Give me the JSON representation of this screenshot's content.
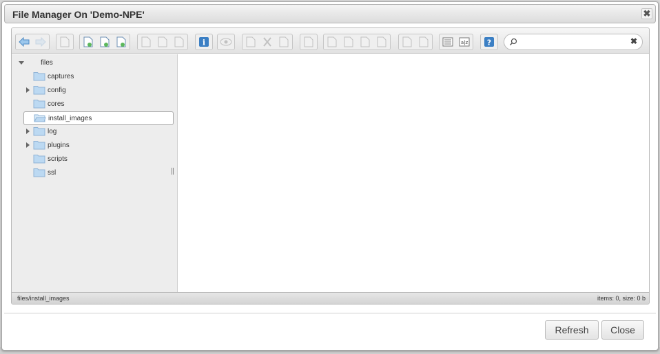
{
  "dialog": {
    "title": "File Manager On 'Demo-NPE'",
    "close_glyph": "✖"
  },
  "toolbar": {
    "groups": [
      {
        "buttons": [
          {
            "icon": "back-arrow-icon",
            "enabled": true
          },
          {
            "icon": "forward-arrow-icon",
            "enabled": false
          }
        ]
      },
      {
        "buttons": [
          {
            "icon": "reload-icon",
            "enabled": false
          }
        ]
      },
      {
        "buttons": [
          {
            "icon": "home-icon",
            "enabled": true
          },
          {
            "icon": "up-folder-icon",
            "enabled": true
          },
          {
            "icon": "save-icon",
            "enabled": true
          }
        ]
      },
      {
        "buttons": [
          {
            "icon": "new-folder-icon",
            "enabled": false
          },
          {
            "icon": "floppy-icon",
            "enabled": false
          },
          {
            "icon": "cursor-icon",
            "enabled": false
          }
        ]
      },
      {
        "buttons": [
          {
            "icon": "info-icon",
            "enabled": true
          }
        ]
      },
      {
        "buttons": [
          {
            "icon": "preview-eye-icon",
            "enabled": false
          }
        ]
      },
      {
        "buttons": [
          {
            "icon": "copy-icon",
            "enabled": false
          },
          {
            "icon": "cut-icon",
            "enabled": false
          },
          {
            "icon": "paste-icon",
            "enabled": false
          }
        ]
      },
      {
        "buttons": [
          {
            "icon": "delete-icon",
            "enabled": false
          }
        ]
      },
      {
        "buttons": [
          {
            "icon": "duplicate-icon",
            "enabled": false
          },
          {
            "icon": "select-icon",
            "enabled": false
          },
          {
            "icon": "edit-icon",
            "enabled": false
          },
          {
            "icon": "resize-icon",
            "enabled": false
          }
        ]
      },
      {
        "buttons": [
          {
            "icon": "extract-icon",
            "enabled": false
          },
          {
            "icon": "archive-icon",
            "enabled": false
          }
        ]
      },
      {
        "buttons": [
          {
            "icon": "list-view-icon",
            "enabled": true
          },
          {
            "icon": "sort-icon",
            "enabled": true
          }
        ]
      },
      {
        "buttons": [
          {
            "icon": "help-icon",
            "enabled": true
          }
        ]
      }
    ],
    "search": {
      "value": "",
      "placeholder": "",
      "clear_glyph": "✖"
    }
  },
  "tree": {
    "root": {
      "label": "files",
      "expanded": true
    },
    "items": [
      {
        "label": "captures",
        "has_children": false,
        "selected": false
      },
      {
        "label": "config",
        "has_children": true,
        "selected": false
      },
      {
        "label": "cores",
        "has_children": false,
        "selected": false
      },
      {
        "label": "install_images",
        "has_children": false,
        "selected": true
      },
      {
        "label": "log",
        "has_children": true,
        "selected": false
      },
      {
        "label": "plugins",
        "has_children": true,
        "selected": false
      },
      {
        "label": "scripts",
        "has_children": false,
        "selected": false
      },
      {
        "label": "ssl",
        "has_children": false,
        "selected": false
      }
    ]
  },
  "status": {
    "path": "files/install_images",
    "summary": "items: 0, size: 0 b"
  },
  "footer": {
    "refresh_label": "Refresh",
    "close_label": "Close"
  },
  "colors": {
    "folder_fill": "#bcd9f2",
    "folder_stroke": "#8fb3d6",
    "accent_blue": "#3b7fc4"
  }
}
